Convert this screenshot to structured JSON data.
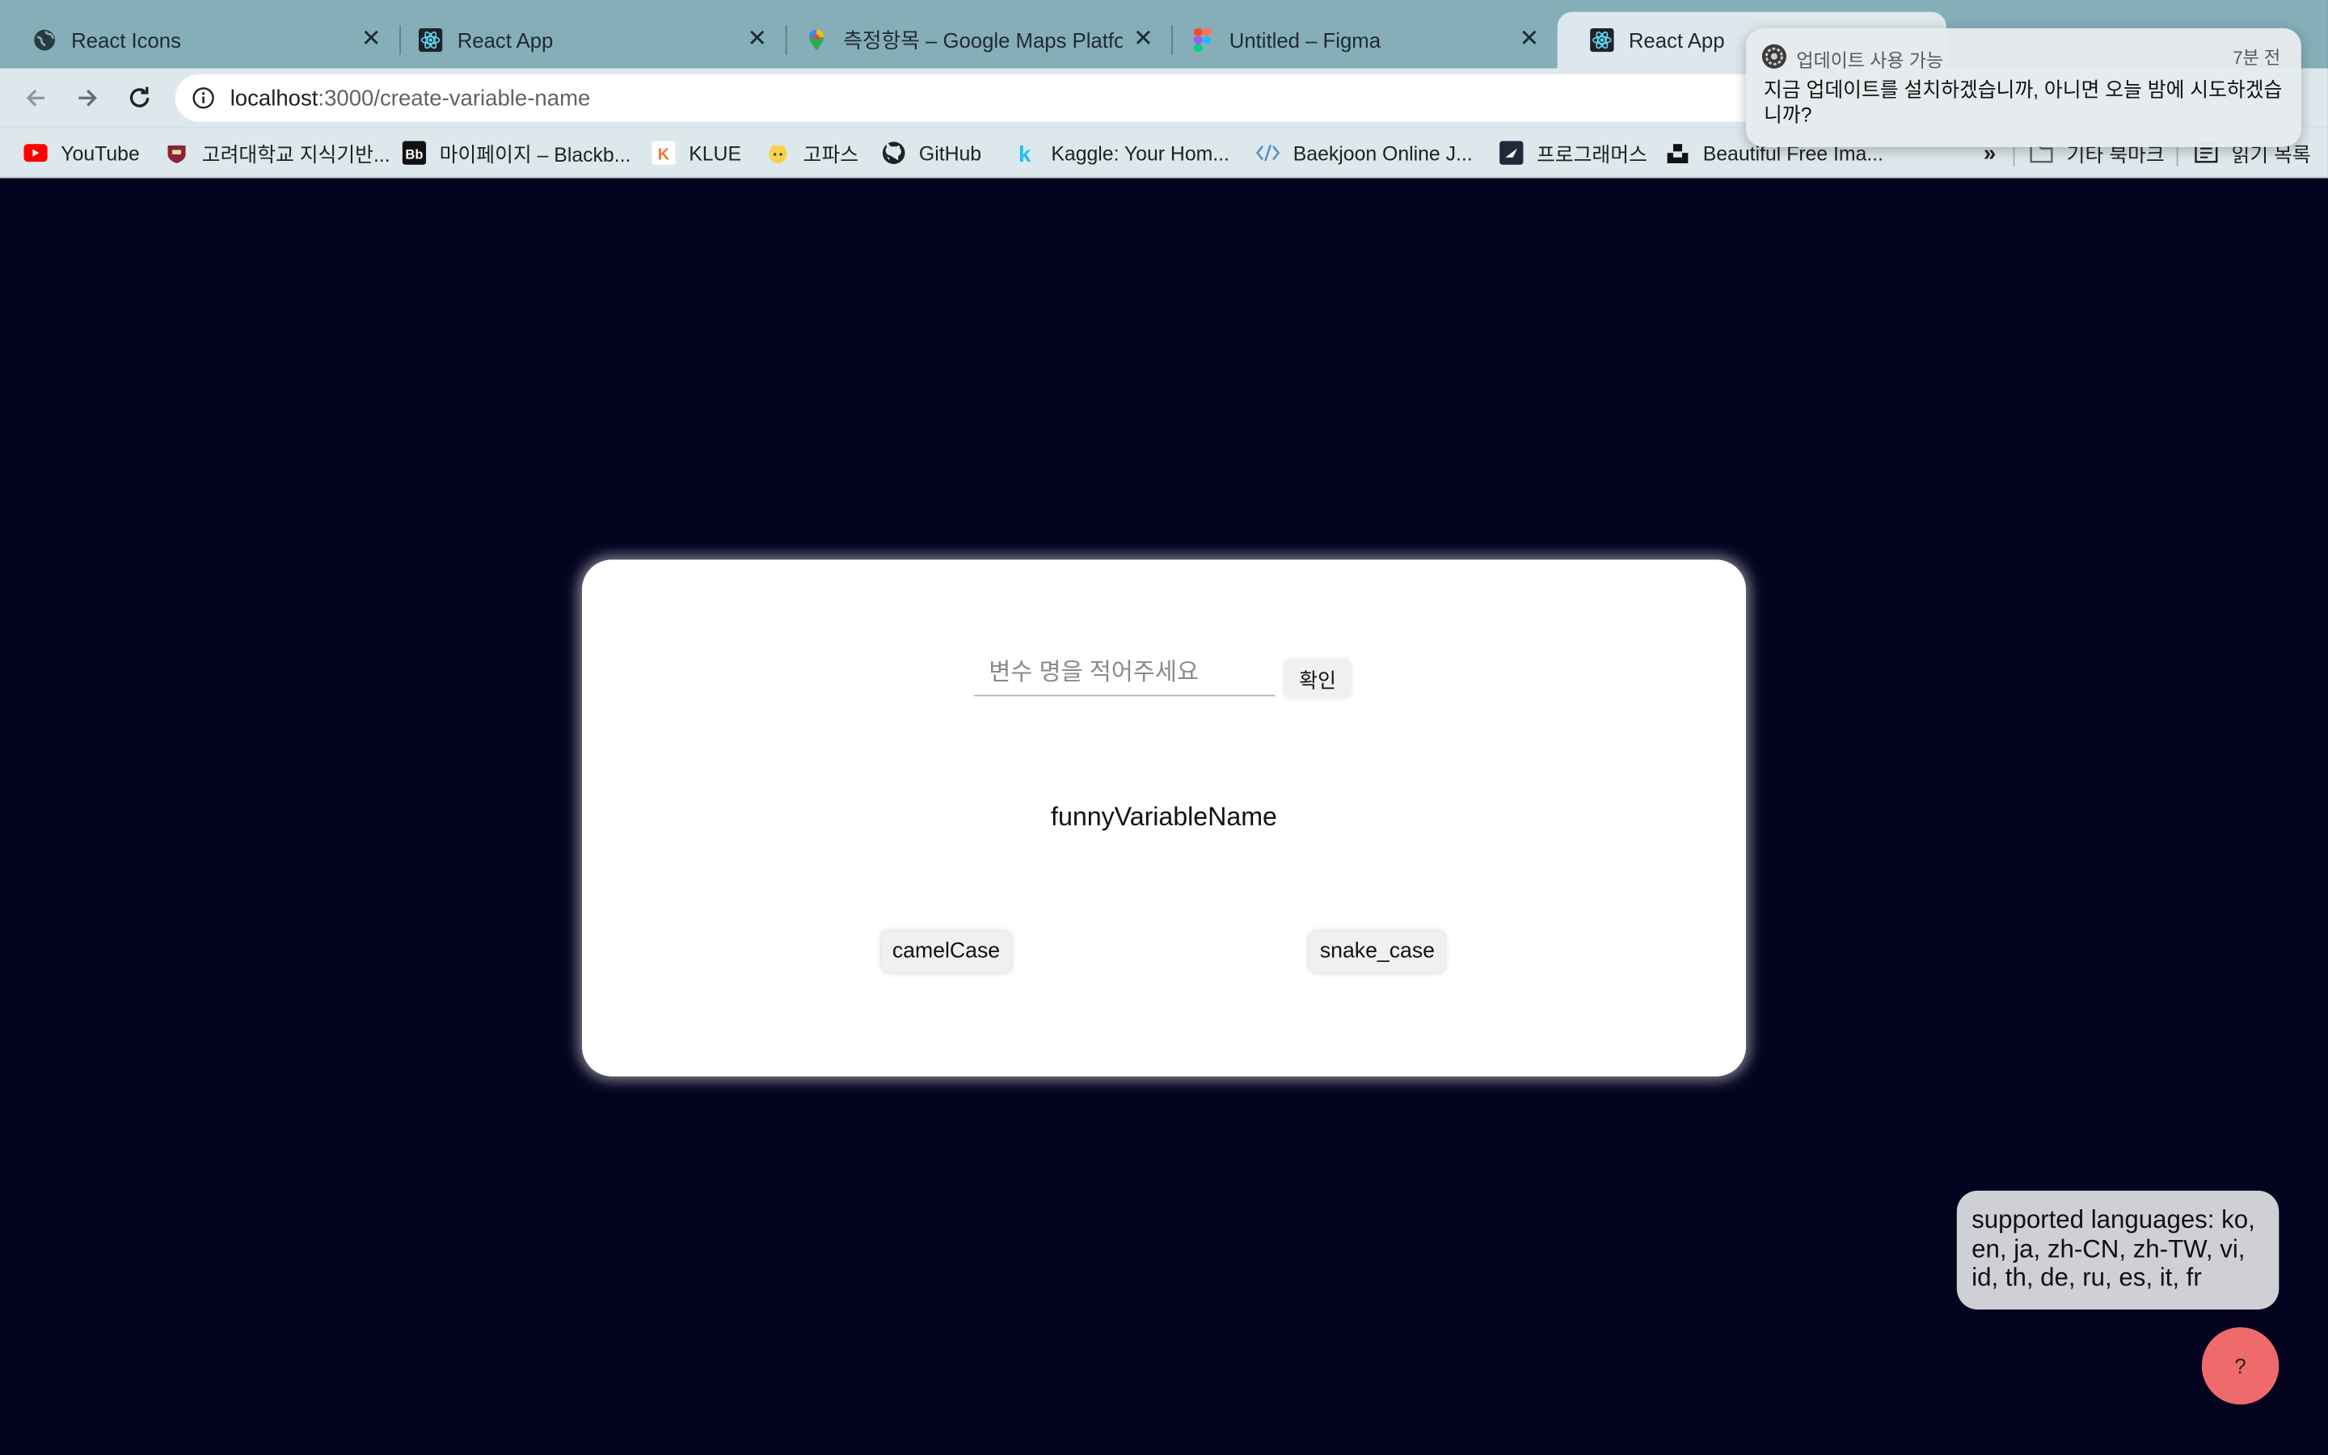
{
  "browser": {
    "tabs": [
      {
        "title": "React Icons",
        "icon": "globe-icon"
      },
      {
        "title": "React App",
        "icon": "react-icon"
      },
      {
        "title": "측정항목 – Google Maps Platform",
        "icon": "google-maps-icon"
      },
      {
        "title": "Untitled – Figma",
        "icon": "figma-icon"
      },
      {
        "title": "React App",
        "icon": "react-icon",
        "active": true
      }
    ],
    "url_host": "localhost",
    "url_path": ":3000/create-variable-name",
    "bookmarks": [
      {
        "label": "YouTube",
        "icon": "youtube-icon"
      },
      {
        "label": "고려대학교 지식기반...",
        "icon": "korea-univ-icon"
      },
      {
        "label": "마이페이지 – Blackb...",
        "icon": "blackboard-icon"
      },
      {
        "label": "KLUE",
        "icon": "klue-icon"
      },
      {
        "label": "고파스",
        "icon": "kopas-icon"
      },
      {
        "label": "GitHub",
        "icon": "github-icon"
      },
      {
        "label": "Kaggle: Your Hom...",
        "icon": "kaggle-icon"
      },
      {
        "label": "Baekjoon Online J...",
        "icon": "code-icon"
      },
      {
        "label": "프로그래머스",
        "icon": "programmers-icon"
      },
      {
        "label": "Beautiful Free Ima...",
        "icon": "unsplash-icon"
      }
    ],
    "overflow_label": "»",
    "other_bookmarks": "기타 북마크",
    "reading_list": "읽기 목록"
  },
  "notification": {
    "app": "업데이트 사용 가능",
    "time": "7분 전",
    "body": "지금 업데이트를 설치하겠습니까, 아니면 오늘 밤에 시도하겠습니까?"
  },
  "app": {
    "input_placeholder": "변수 명을 적어주세요",
    "confirm_label": "확인",
    "result_text": "funnyVariableName",
    "camel_label": "camelCase",
    "snake_label": "snake_case",
    "languages_text": "supported languages: ko, en, ja, zh-CN, zh-TW, vi, id, th, de, ru, es, it, fr",
    "help_label": "?"
  },
  "colors": {
    "page_background": "#03021f",
    "tab_strip": "#86aeb8",
    "toolbar": "#dde8ec",
    "help_button": "#ef6b6b"
  }
}
